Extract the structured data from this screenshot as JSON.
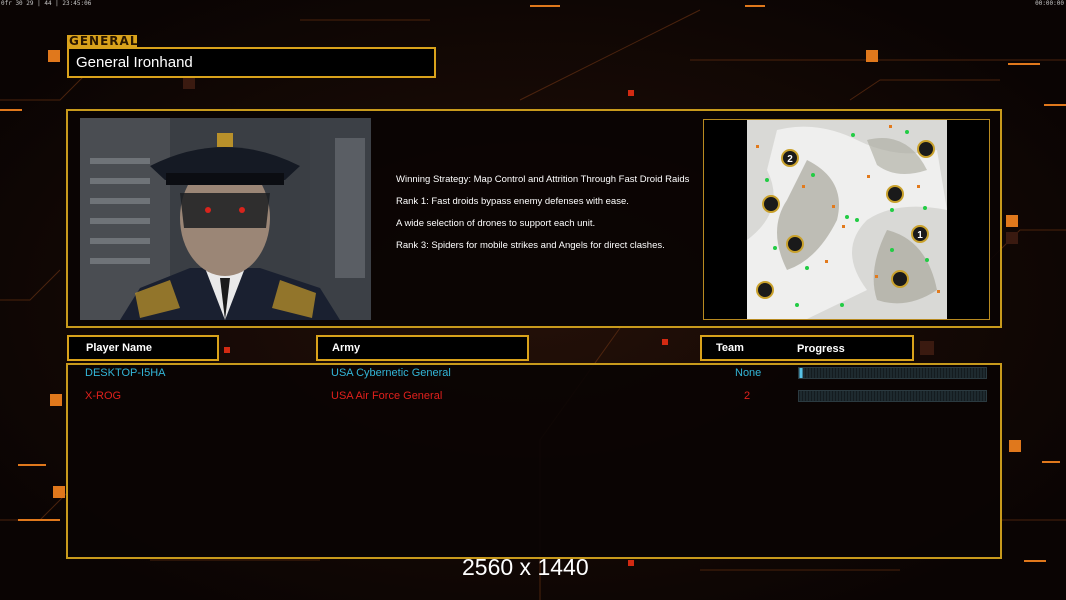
{
  "status_bar": {
    "left": "0fr 30 29 | 44 | 23:45:06",
    "right": "00:00:00"
  },
  "general": {
    "section_tag": "GENERAL",
    "name": "General Ironhand",
    "description": [
      "Winning Strategy: Map Control and Attrition Through Fast Droid Raids",
      "Rank 1: Fast droids bypass enemy defenses with ease.",
      "A wide selection of drones to support each unit.",
      "Rank 3: Spiders for mobile strikes and Angels for direct clashes."
    ]
  },
  "map": {
    "start_positions": [
      "2",
      "1"
    ]
  },
  "table": {
    "headers": {
      "player_name": "Player Name",
      "army": "Army",
      "team": "Team",
      "progress": "Progress"
    },
    "rows": [
      {
        "player": "DESKTOP-I5HA",
        "army": "USA Cybernetic General",
        "team": "None",
        "progress": 0.02,
        "color": "#33b6d8"
      },
      {
        "player": "X-ROG",
        "army": "USA Air Force General",
        "team": "2",
        "progress": 0.0,
        "color": "#e0201c"
      }
    ]
  },
  "resolution_label": "2560 x 1440",
  "colors": {
    "accent": "#d9a21b",
    "player1": "#33b6d8",
    "player2": "#e0201c"
  }
}
